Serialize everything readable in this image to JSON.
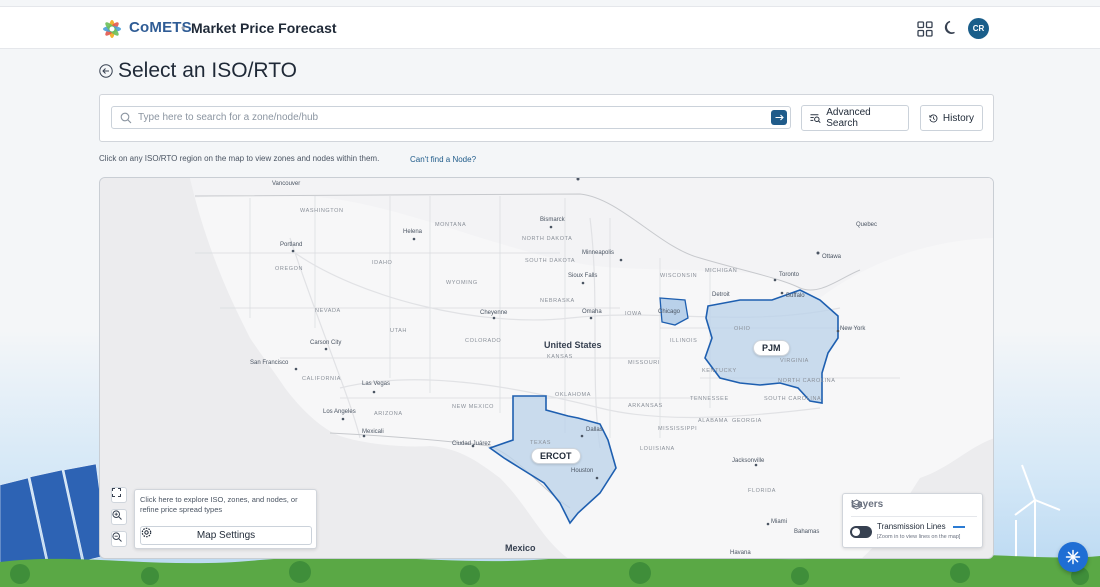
{
  "header": {
    "brand": "CoMETS",
    "separator": "•",
    "app_title": "Market Price Forecast",
    "avatar_initials": "CR",
    "icons": [
      "apps-grid-icon",
      "moon-icon"
    ]
  },
  "page": {
    "title": "Select an ISO/RTO"
  },
  "search": {
    "placeholder": "Type here to search for a zone/node/hub",
    "value": "",
    "advanced_label": "Advanced Search",
    "history_label": "History"
  },
  "hint": {
    "text": "Click on any ISO/RTO region on the map to view zones and nodes within them.",
    "link": "Can't find a Node?"
  },
  "map": {
    "regions": [
      "PJM",
      "ERCOT"
    ],
    "country_labels": [
      "United States",
      "Mexico"
    ],
    "cities": [
      "Vancouver",
      "Portland",
      "Helena",
      "Bismarck",
      "Minneapolis",
      "Ottawa",
      "Quebec",
      "Toronto",
      "Detroit",
      "Buffalo",
      "Chicago",
      "Cheyenne",
      "Omaha",
      "Sioux Falls",
      "Carson City",
      "San Francisco",
      "Las Vegas",
      "Los Angeles",
      "Mexicali",
      "Ciudad Juárez",
      "Dallas",
      "Houston",
      "Jacksonville",
      "Miami",
      "Bahamas",
      "Havana",
      "New York"
    ],
    "states": [
      "WASHINGTON",
      "MONTANA",
      "NORTH DAKOTA",
      "SOUTH DAKOTA",
      "IDAHO",
      "OREGON",
      "WYOMING",
      "NEBRASKA",
      "NEVADA",
      "UTAH",
      "COLORADO",
      "KANSAS",
      "CALIFORNIA",
      "ARIZONA",
      "NEW MEXICO",
      "OKLAHOMA",
      "TEXAS",
      "IOWA",
      "MISSOURI",
      "ILLINOIS",
      "OHIO",
      "KENTUCKY",
      "TENNESSEE",
      "GEORGIA",
      "ALABAMA",
      "MISSISSIPPI",
      "ARKANSAS",
      "LOUISIANA",
      "WISCONSIN",
      "MICHIGAN",
      "FLORIDA",
      "VIRGINIA",
      "NORTH CAROLINA",
      "SOUTH CAROLINA"
    ],
    "settings_hint": "Click here to explore ISO, zones, and nodes, or refine price spread types",
    "settings_label": "Map Settings",
    "layers_title": "Layers",
    "layer_name": "Transmission Lines",
    "layer_note": "[Zoom in to view lines on the map]",
    "layer_enabled": false,
    "controls": [
      "expand-icon",
      "zoom-in-icon",
      "zoom-out-icon"
    ]
  },
  "colors": {
    "brand": "#2f5c95",
    "region_fill": "#b9d1ea",
    "region_stroke": "#1e5fb0",
    "transmission_line": "#2b7bd3",
    "chat_fab": "#1f6ed4"
  }
}
